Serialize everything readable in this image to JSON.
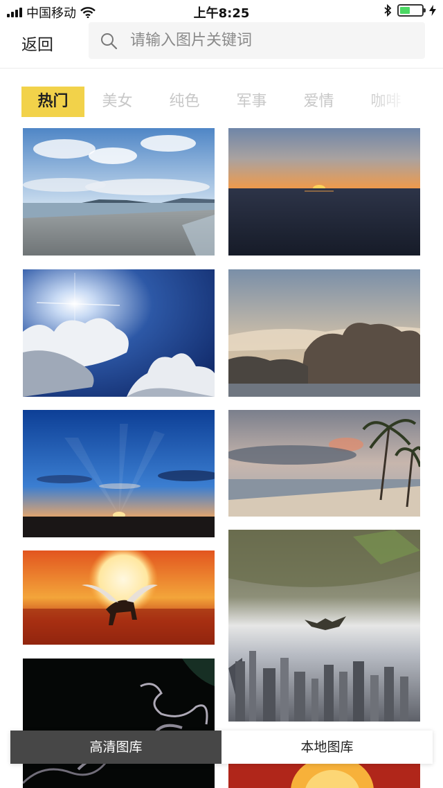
{
  "status_bar": {
    "carrier": "中国移动",
    "time": "上午8:25",
    "battery_level": 0.45
  },
  "header": {
    "back_label": "返回",
    "search_placeholder": "请输入图片关键词",
    "search_value": ""
  },
  "tabs": [
    {
      "label": "热门",
      "active": true
    },
    {
      "label": "美女",
      "active": false
    },
    {
      "label": "纯色",
      "active": false
    },
    {
      "label": "军事",
      "active": false
    },
    {
      "label": "爱情",
      "active": false
    },
    {
      "label": "咖啡",
      "active": false
    }
  ],
  "photos": [
    {
      "subject": "beach with clouds"
    },
    {
      "subject": "sunset over sea"
    },
    {
      "subject": "sun and clouds"
    },
    {
      "subject": "lake with trees"
    },
    {
      "subject": "sunrise over horizon"
    },
    {
      "subject": "beach with palm trees"
    },
    {
      "subject": "pegasus at sunset"
    },
    {
      "subject": "skydiver above city"
    },
    {
      "subject": "smoke on black"
    },
    {
      "subject": "sun partially visible"
    }
  ],
  "bottom_toggle": {
    "hd_gallery_label": "高清图库",
    "local_gallery_label": "本地图库"
  },
  "colors": {
    "accent_tab": "#f2d24a",
    "inactive_tab_text": "#c7c7c7",
    "dark_button": "#474747"
  }
}
